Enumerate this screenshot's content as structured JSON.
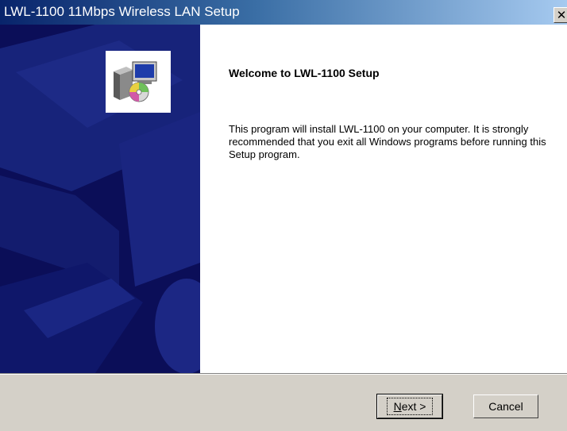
{
  "window": {
    "title": "LWL-1100 11Mbps Wireless LAN Setup",
    "close_label": "✕"
  },
  "welcome": {
    "title": "Welcome to LWL-1100 Setup",
    "body": "This program will install LWL-1100 on your computer.  It is strongly recommended that you exit all Windows programs before running this Setup program."
  },
  "buttons": {
    "next_mnemonic": "N",
    "next_rest": "ext >",
    "cancel": "Cancel"
  },
  "icons": {
    "setup": "setup-installer-icon",
    "close": "close-icon"
  },
  "colors": {
    "side_panel": "#0b0e58",
    "titlebar_start": "#08246b",
    "titlebar_end": "#a6caf0",
    "dialog_bg": "#d4d0c8"
  }
}
